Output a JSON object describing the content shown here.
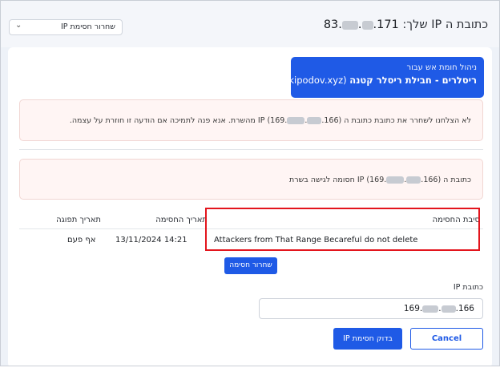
{
  "header": {
    "ip_label": "כתובת ה IP שלך:",
    "ip_prefix": "83.",
    "ip_suffix": ".171",
    "dropdown_label": "שחרור חסימת IP"
  },
  "banner": {
    "line1": "ניהול חומת אש עבור",
    "line2_bold": "ריסלרים - חבילת ריסלר קטנה",
    "line2_domain": "(kipodov.xyz)"
  },
  "alert_failed": {
    "part1": "לא הצלחנו לשחרר את כתובת כתובת ה IP (169.",
    "part2": ".166) מהשרת. אנא פנה לתמיכה אם הודעה זו חוזרת על עצמה."
  },
  "alert_blocked": {
    "part1": "כתובת ה IP (169.",
    "part2": ".166) חסומה לגישה בשרת"
  },
  "table": {
    "headers": {
      "reason": "סיבת החסימה",
      "block_date": "תאריך החסימה",
      "expiry": "תאריך תפוגה"
    },
    "row": {
      "reason": "Attackers from That Range Becareful do not delete",
      "block_date": "13/11/2024 14:21",
      "expiry": "אף פעם"
    }
  },
  "release_button": "שחרור חסימה",
  "form": {
    "ip_label": "כתובת IP",
    "ip_prefix": "169.",
    "ip_suffix": ".166",
    "check_button": "בדוק חסימת IP",
    "cancel_button": "Cancel"
  },
  "colors": {
    "primary": "#1f5ae6",
    "alert_bg": "#fff5f4",
    "highlight": "#e3151d"
  }
}
